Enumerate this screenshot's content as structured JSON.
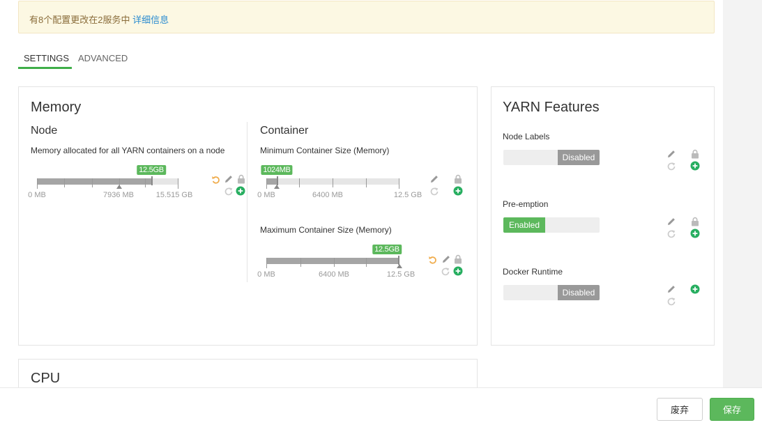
{
  "alert": {
    "text": "有8个配置更改在2服务中",
    "link": "详细信息"
  },
  "tabs": [
    {
      "label": "SETTINGS",
      "active": true
    },
    {
      "label": "ADVANCED",
      "active": false
    }
  ],
  "memory": {
    "title": "Memory",
    "node": {
      "title": "Node",
      "description": "Memory allocated for all YARN containers on a node",
      "slider": {
        "value_label": "12.5GB",
        "value_fraction": 0.81,
        "marker_fraction": 0.58,
        "min_label": "0 MB",
        "mid_label": "7936 MB",
        "max_label": "15.515 GB"
      }
    },
    "container": {
      "title": "Container",
      "min": {
        "description": "Minimum Container Size (Memory)",
        "slider": {
          "value_label": "1024MB",
          "value_fraction": 0.08,
          "min_label": "0 MB",
          "mid_label": "6400 MB",
          "max_label": "12.5 GB"
        }
      },
      "max": {
        "description": "Maximum Container Size (Memory)",
        "slider": {
          "value_label": "12.5GB",
          "value_fraction": 1.0,
          "min_label": "0 MB",
          "mid_label": "6400 MB",
          "max_label": "12.5 GB"
        }
      }
    }
  },
  "cpu": {
    "title": "CPU"
  },
  "yarn_features": {
    "title": "YARN Features",
    "items": [
      {
        "label": "Node Labels",
        "state": "Disabled"
      },
      {
        "label": "Pre-emption",
        "state": "Enabled"
      },
      {
        "label": "Docker Runtime",
        "state": "Disabled"
      }
    ]
  },
  "footer": {
    "discard_label": "废弃",
    "save_label": "保存"
  },
  "colors": {
    "accent": "#5cb85c",
    "undo": "#f0ad4e",
    "link": "#2a8bd0",
    "alert_bg": "#fcf8e3"
  },
  "icons": [
    "undo-icon",
    "pencil-icon",
    "lock-icon",
    "refresh-icon",
    "plus-circle-icon"
  ]
}
